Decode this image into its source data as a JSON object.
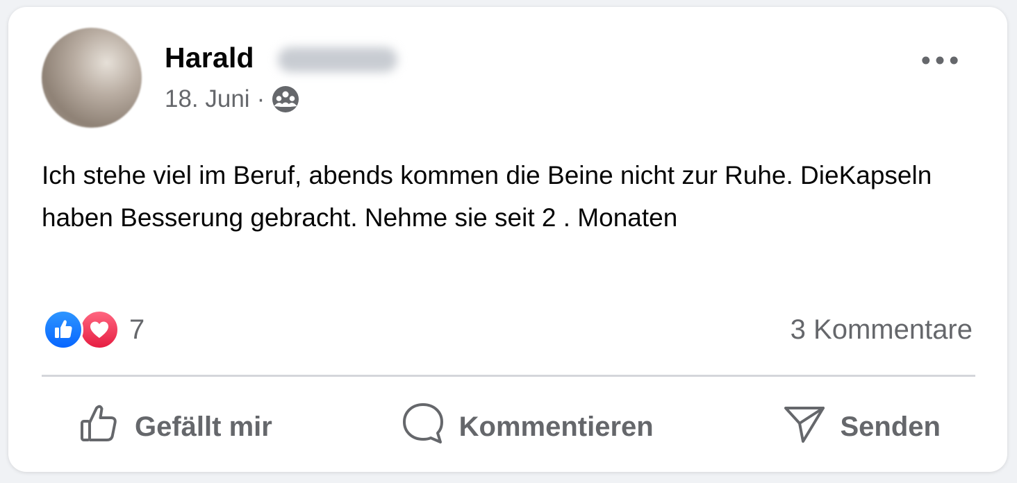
{
  "post": {
    "author_first_name": "Harald",
    "date": "18. Juni",
    "separator": "·",
    "audience_icon": "group-icon",
    "text": "Ich stehe viel im Beruf, abends kommen die Beine nicht zur Ruhe. DieKapseln haben Besserung gebracht. Nehme sie seit 2 . Monaten",
    "more_icon": "more-options-icon"
  },
  "reactions": {
    "icons": [
      "like-icon",
      "love-icon"
    ],
    "count": "7"
  },
  "comments": {
    "label": "3 Kommentare"
  },
  "actions": {
    "like_label": "Gefällt mir",
    "comment_label": "Kommentieren",
    "share_label": "Senden"
  },
  "colors": {
    "like_blue": "#0866ff",
    "love_red": "#e61e42",
    "secondary_text": "#65676b",
    "primary_text": "#050505"
  }
}
